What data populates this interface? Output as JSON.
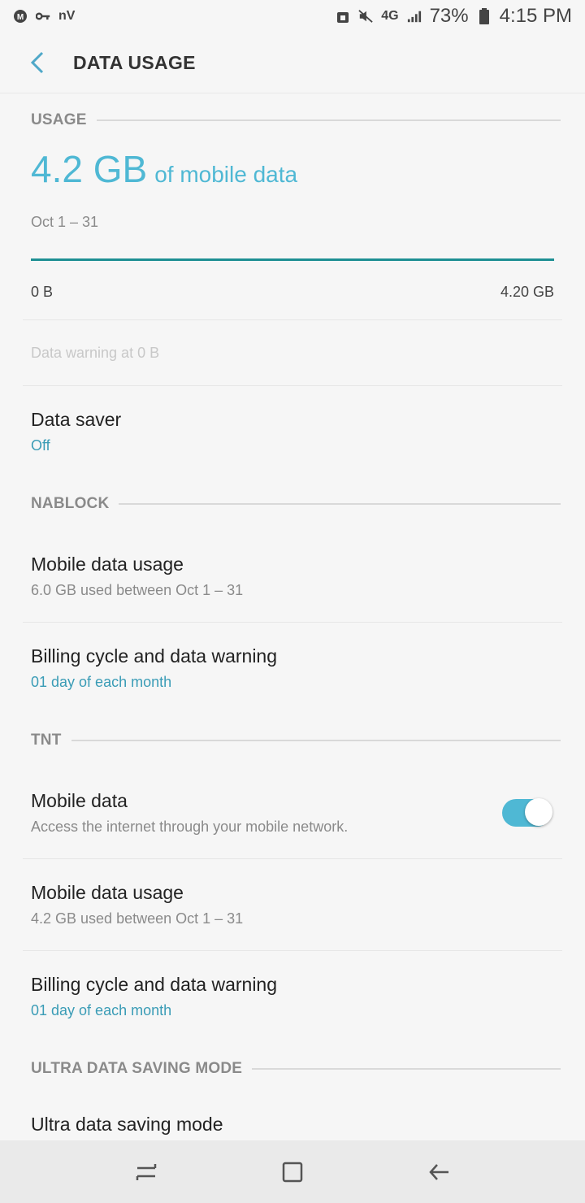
{
  "status_bar": {
    "left_icons": [
      "m-icon",
      "key-icon"
    ],
    "left_text": "nV",
    "network": "4G",
    "battery": "73%",
    "time": "4:15 PM"
  },
  "app_bar": {
    "title": "DATA USAGE"
  },
  "usage": {
    "section_label": "USAGE",
    "amount": "4.2 GB",
    "unit_label": "of mobile data",
    "range": "Oct 1 – 31",
    "scale_min": "0 B",
    "scale_max": "4.20 GB",
    "warning": "Data warning at 0 B"
  },
  "data_saver": {
    "title": "Data saver",
    "status": "Off"
  },
  "nablock": {
    "section_label": "NABLOCK",
    "usage_title": "Mobile data usage",
    "usage_sub": "6.0 GB used between Oct 1 – 31",
    "billing_title": "Billing cycle and data warning",
    "billing_sub": "01 day of each month"
  },
  "tnt": {
    "section_label": "TNT",
    "mobile_data_title": "Mobile data",
    "mobile_data_sub": "Access the internet through your mobile network.",
    "mobile_data_enabled": true,
    "usage_title": "Mobile data usage",
    "usage_sub": "4.2 GB used between Oct 1 – 31",
    "billing_title": "Billing cycle and data warning",
    "billing_sub": "01 day of each month"
  },
  "ultra": {
    "section_label": "ULTRA DATA SAVING MODE",
    "title": "Ultra data saving mode"
  },
  "colors": {
    "accent": "#4fb8d4",
    "link": "#3a9cb6",
    "bar": "#1e8f93"
  }
}
